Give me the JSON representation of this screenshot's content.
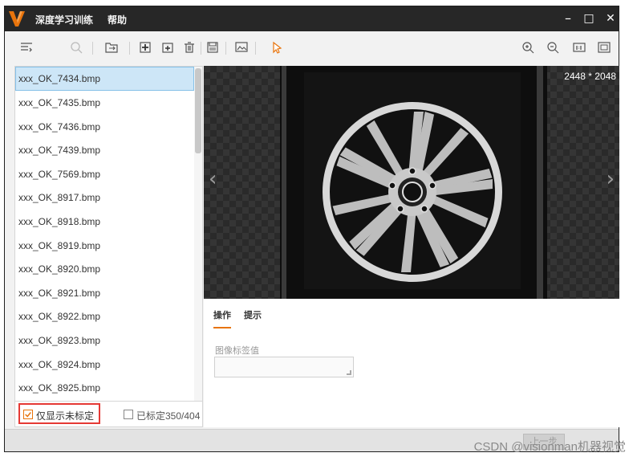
{
  "titlebar": {
    "menu": [
      {
        "label": "深度学习训练"
      },
      {
        "label": "帮助"
      }
    ],
    "minimize": "–",
    "maximize": "□",
    "close": "✕"
  },
  "files": [
    "xxx_OK_7434.bmp",
    "xxx_OK_7435.bmp",
    "xxx_OK_7436.bmp",
    "xxx_OK_7439.bmp",
    "xxx_OK_7569.bmp",
    "xxx_OK_8917.bmp",
    "xxx_OK_8918.bmp",
    "xxx_OK_8919.bmp",
    "xxx_OK_8920.bmp",
    "xxx_OK_8921.bmp",
    "xxx_OK_8922.bmp",
    "xxx_OK_8923.bmp",
    "xxx_OK_8924.bmp",
    "xxx_OK_8925.bmp"
  ],
  "filter": {
    "only_unlabeled": "仅显示未标定",
    "labeled_count": "已标定350/404"
  },
  "viewer": {
    "dimensions": "2448 * 2048",
    "prev": "‹",
    "next": "›"
  },
  "tabs": [
    {
      "label": "操作"
    },
    {
      "label": "提示"
    }
  ],
  "label_field": {
    "label": "图像标签值",
    "value": ""
  },
  "status": {
    "button": "上一步"
  },
  "watermark": "CSDN @visionman机器视觉",
  "colors": {
    "accent": "#e8740c",
    "selected_bg": "#cde6f7",
    "titlebar": "#272727",
    "highlight": "#e53935"
  }
}
